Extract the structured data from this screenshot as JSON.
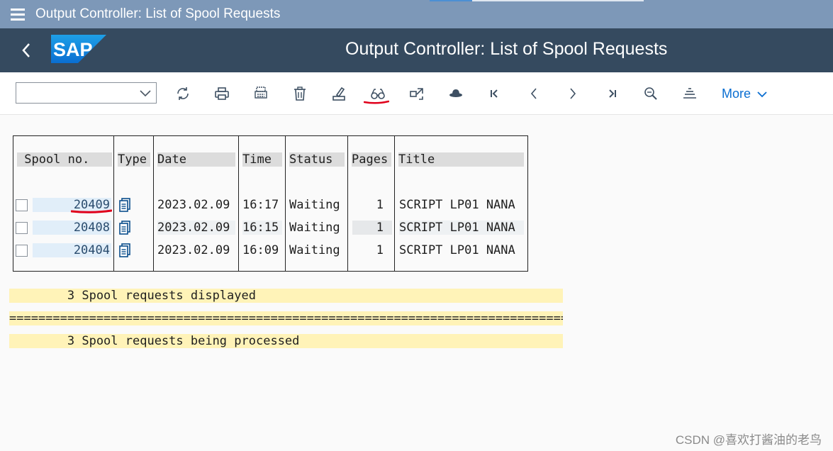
{
  "window": {
    "title": "Output Controller: List of Spool Requests",
    "progress_fraction": 0.2
  },
  "shell": {
    "title": "Output Controller: List of Spool Requests",
    "logo_text": "SAP"
  },
  "toolbar": {
    "combo_value": "",
    "icons": [
      "refresh-icon",
      "print-icon",
      "print-preview-icon",
      "delete-icon",
      "edit-icon",
      "display-contents-icon",
      "forward-icon",
      "hat-icon",
      "first-page-icon",
      "previous-page-icon",
      "next-page-icon",
      "last-page-icon",
      "find-icon",
      "align-icon"
    ],
    "more_label": "More"
  },
  "table": {
    "headers": {
      "spool_no": " Spool no. ",
      "type": "Type",
      "date": "Date",
      "time": "Time",
      "status": "Status",
      "pages": "Pages",
      "title": "Title"
    },
    "rows": [
      {
        "spool_no": "20409",
        "date": "2023.02.09",
        "time": "16:17",
        "status": "Waiting",
        "pages": "1",
        "title": "SCRIPT LP01 NANA"
      },
      {
        "spool_no": "20408",
        "date": "2023.02.09",
        "time": "16:15",
        "status": "Waiting",
        "pages": "1",
        "title": "SCRIPT LP01 NANA"
      },
      {
        "spool_no": "20404",
        "date": "2023.02.09",
        "time": "16:09",
        "status": "Waiting",
        "pages": "1",
        "title": "SCRIPT LP01 NANA"
      }
    ]
  },
  "summary": {
    "displayed": "        3 Spool requests displayed",
    "separator": "=========================================================================================",
    "processed": "        3 Spool requests being processed"
  },
  "watermark": "CSDN @喜欢打酱油的老鸟",
  "colors": {
    "titlebar": "#7d98b8",
    "shell": "#354a5f",
    "accent": "#0a6ed1",
    "band": "#fff3b8",
    "annotation": "#e0001b"
  }
}
